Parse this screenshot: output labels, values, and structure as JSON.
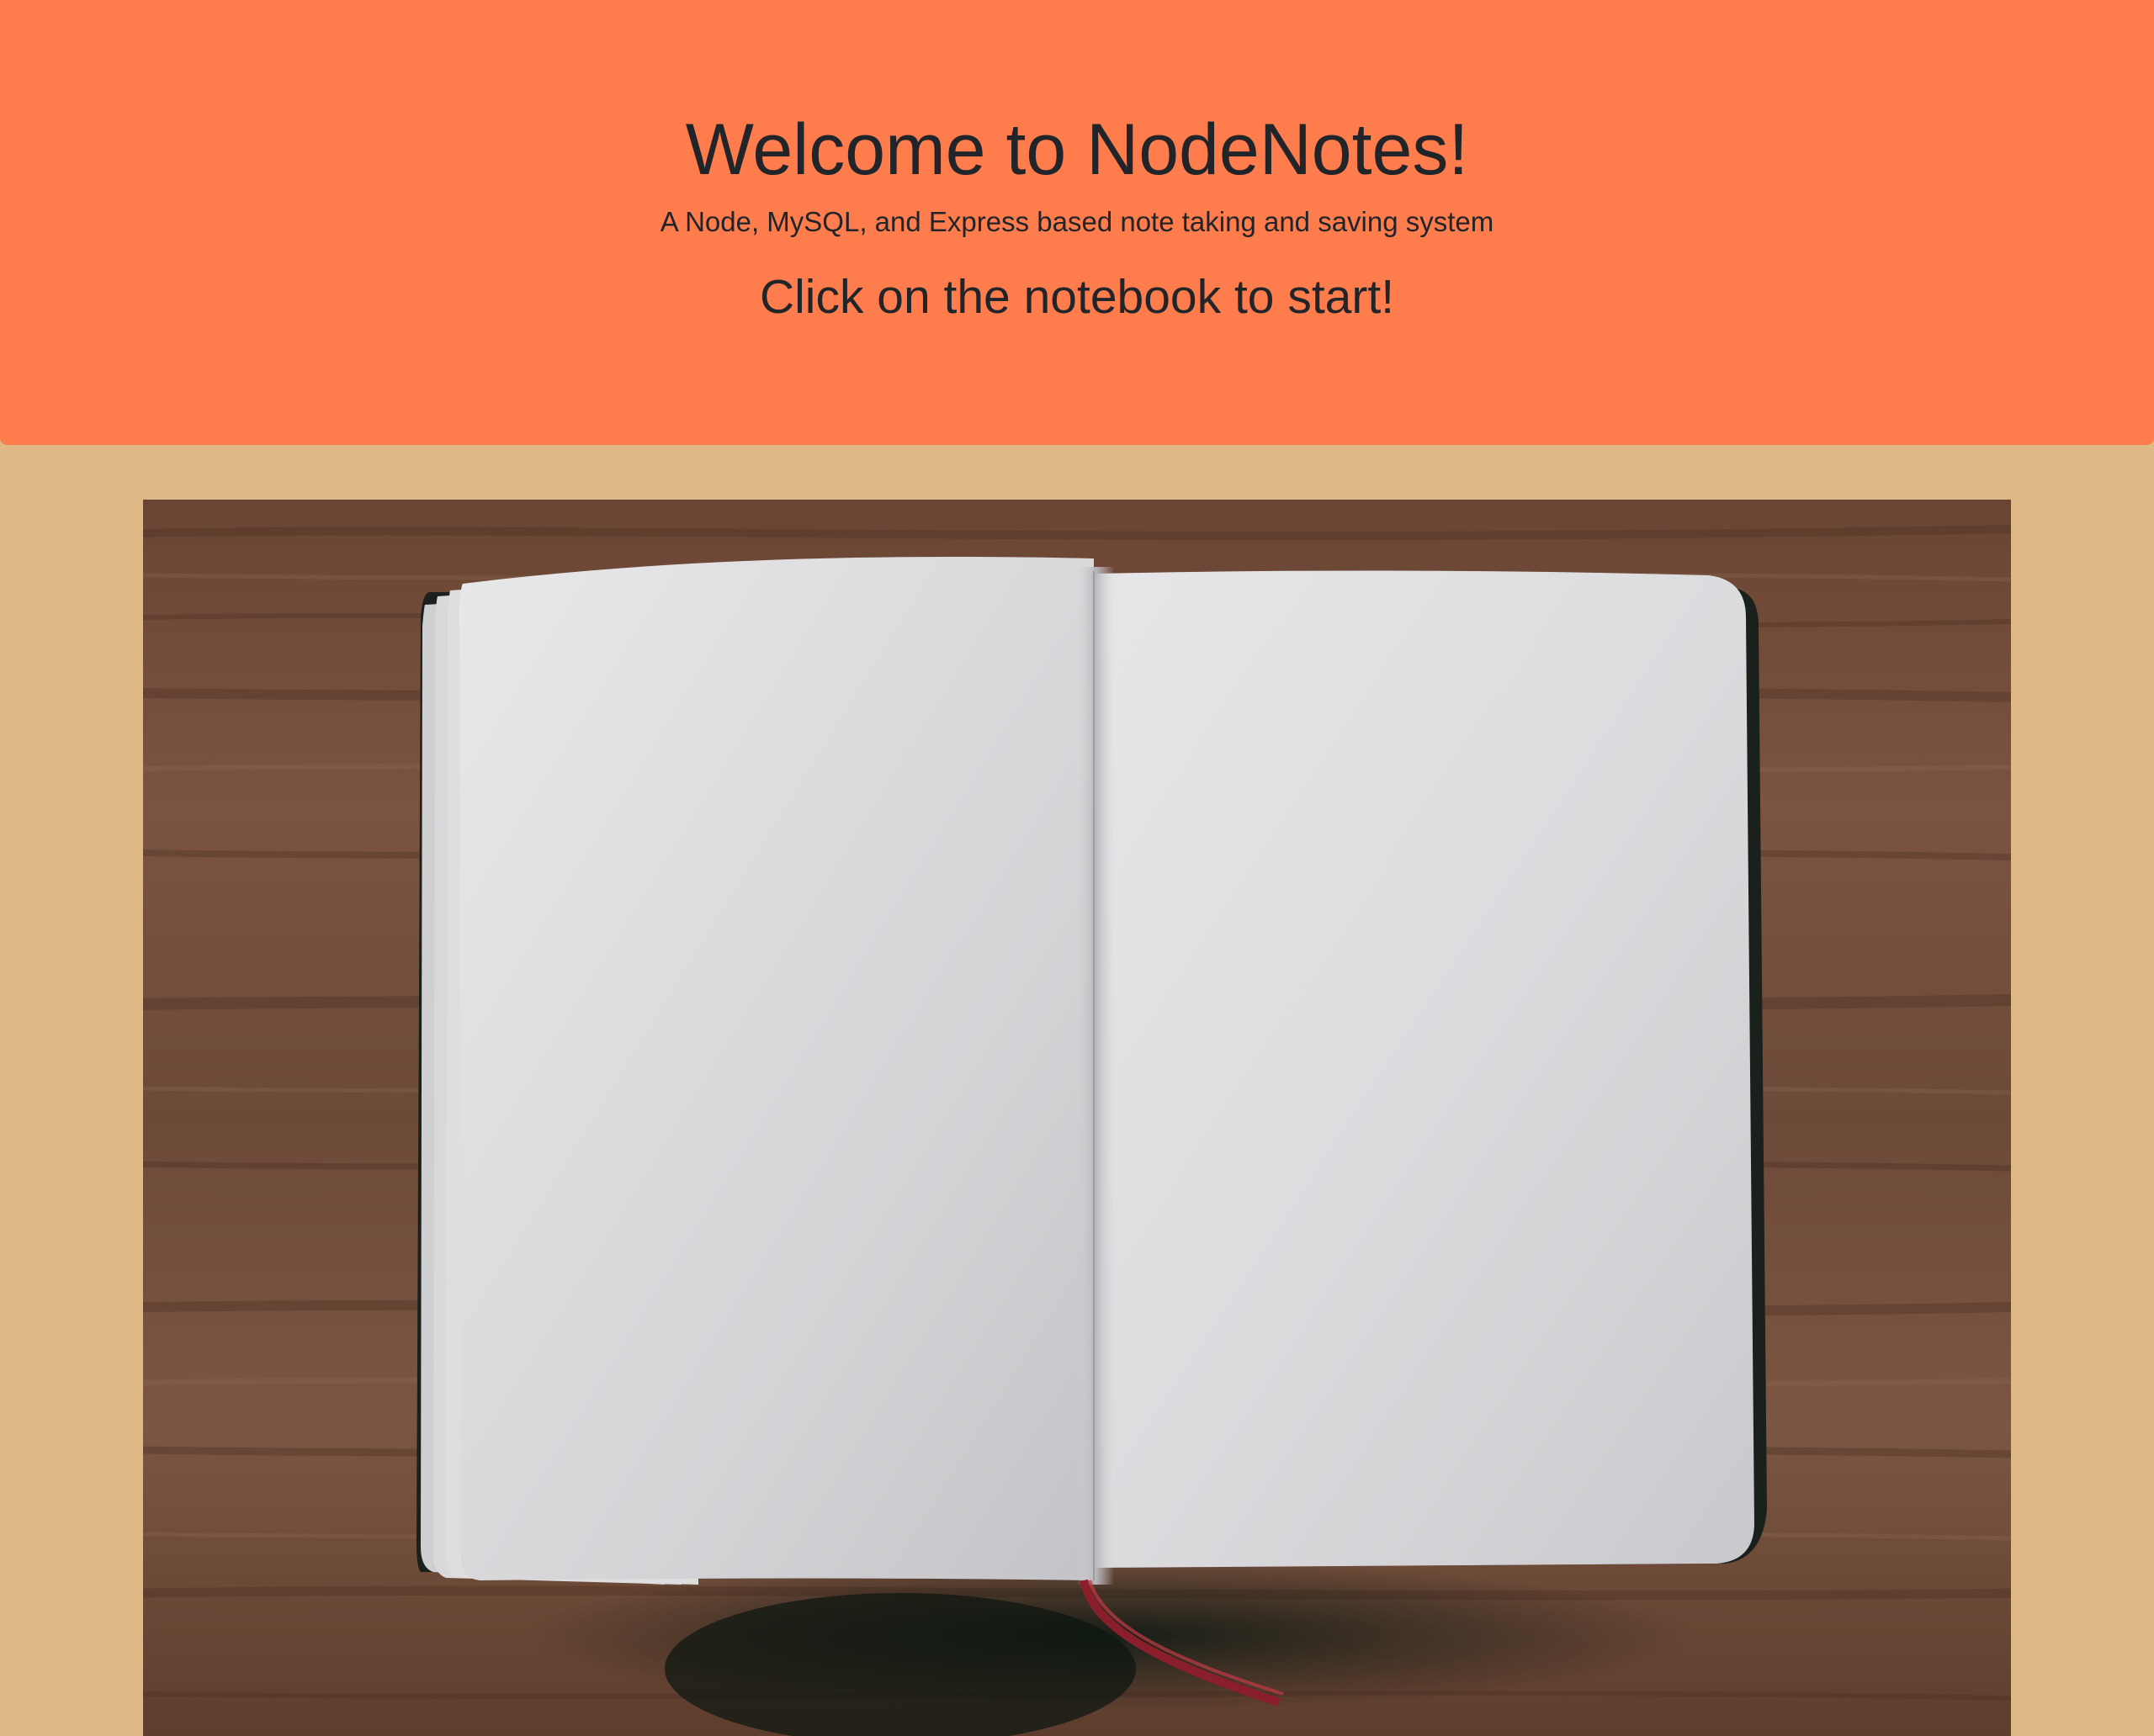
{
  "header": {
    "title": "Welcome to NodeNotes!",
    "subtitle": "A Node, MySQL, and Express based note taking and saving system",
    "cta": "Click on the notebook to start!"
  },
  "notebook_image": {
    "description_alt": "Open blank notebook on wooden desk"
  },
  "colors": {
    "page_background": "#dfb985",
    "header_background": "#ff7c4c",
    "text": "#212529",
    "desk_wood": "#6e4a36",
    "paper": "#e2e2e4"
  }
}
